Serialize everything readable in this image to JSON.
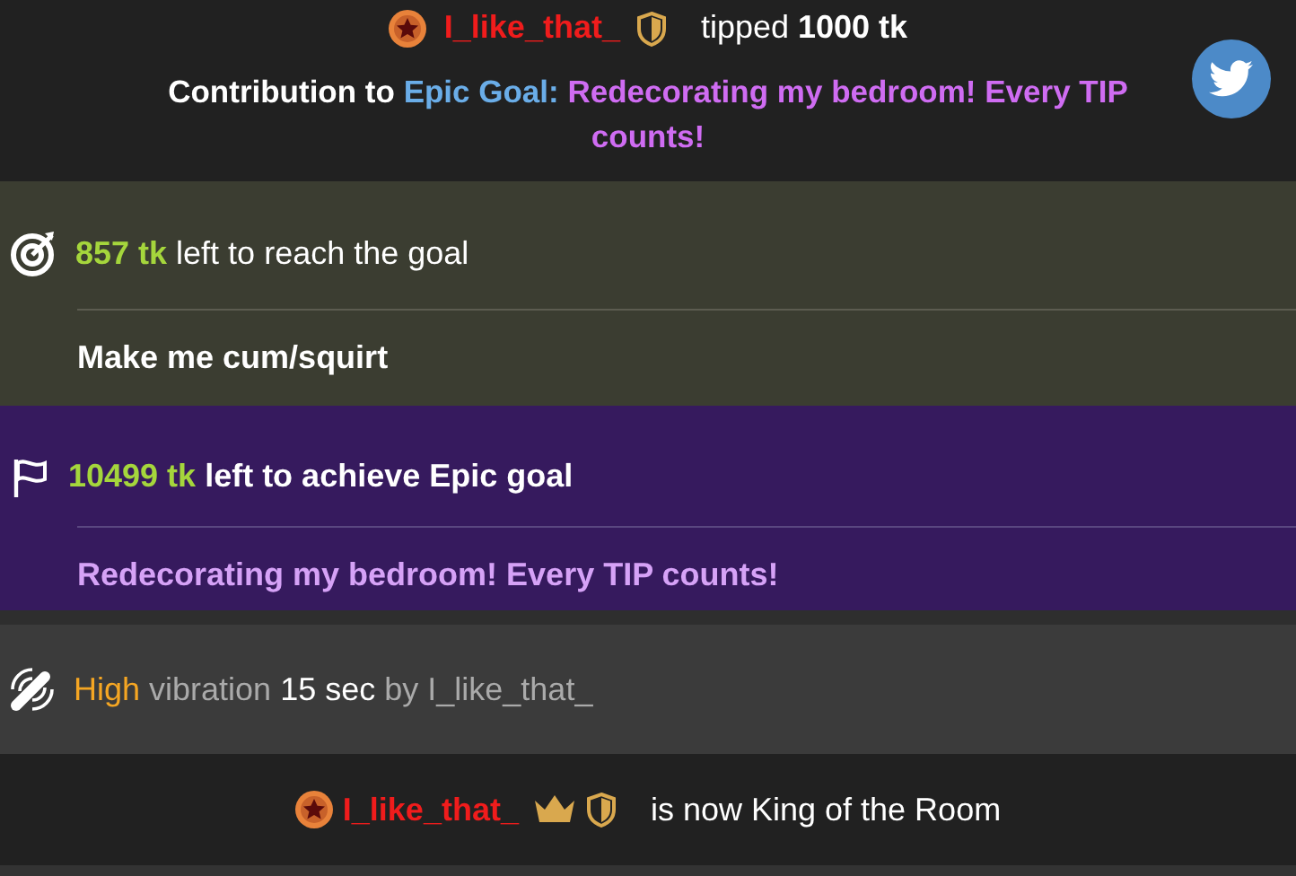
{
  "messages": [
    {
      "kind": "tip",
      "user": "I_like_that_",
      "action": "tipped",
      "amount": "1000 tk",
      "contribution": {
        "prefix": "Contribution to",
        "goal_label": "Epic Goal:",
        "goal_text": "Redecorating my bedroom! Every TIP counts!"
      }
    },
    {
      "kind": "goal",
      "amount": "857 tk",
      "text": "left to reach the goal",
      "title": "Make me cum/squirt"
    },
    {
      "kind": "epic_goal",
      "amount": "10499 tk",
      "text": "left to achieve Epic goal",
      "title": "Redecorating my bedroom! Every TIP counts!"
    },
    {
      "kind": "vibration",
      "strength": "High",
      "word": "vibration",
      "duration": "15 sec",
      "by": "by I_like_that_"
    },
    {
      "kind": "king",
      "user": "I_like_that_",
      "text": "is now King of the Room"
    }
  ]
}
